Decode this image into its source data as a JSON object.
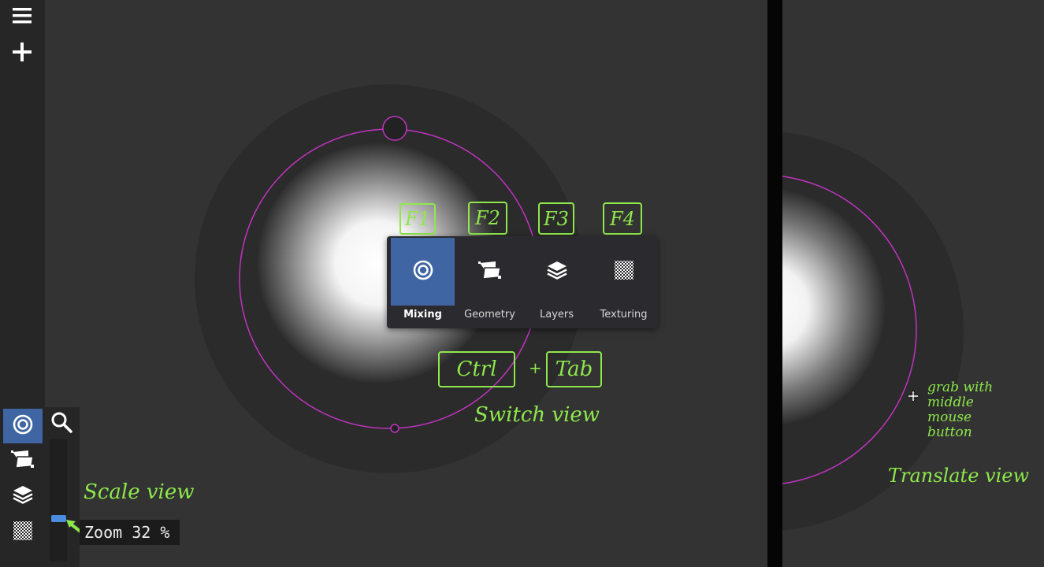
{
  "colors": {
    "background": "#333333",
    "toolbar": "#262626",
    "accent": "#3f66a3",
    "annotation": "#8ee84b",
    "guide_circle": "#c033c0",
    "zoom_handle": "#4a8de0"
  },
  "toolbar": {
    "icons": [
      "menu-icon",
      "plus-icon"
    ]
  },
  "view_switcher": {
    "items": [
      {
        "label": "Mixing",
        "icon": "target-icon",
        "key": "F1",
        "active": true
      },
      {
        "label": "Geometry",
        "icon": "geometry-icon",
        "key": "F2",
        "active": false
      },
      {
        "label": "Layers",
        "icon": "layers-icon",
        "key": "F3",
        "active": false
      },
      {
        "label": "Texturing",
        "icon": "checkerboard-icon",
        "key": "F4",
        "active": false
      }
    ]
  },
  "annotations": {
    "shortcut_key1": "Ctrl",
    "shortcut_plus": "+",
    "shortcut_key2": "Tab",
    "switch_view": "Switch view",
    "scale_view": "Scale view",
    "grab_line1": "grab with",
    "grab_line2": "middle",
    "grab_line3": "mouse",
    "grab_line4": "button",
    "translate_view": "Translate view"
  },
  "view_panel": {
    "icons": [
      "target-icon",
      "geometry-icon",
      "layers-icon",
      "checkerboard-icon",
      "search-icon"
    ],
    "zoom_label": "Zoom 32 %",
    "zoom_percent": 32
  }
}
